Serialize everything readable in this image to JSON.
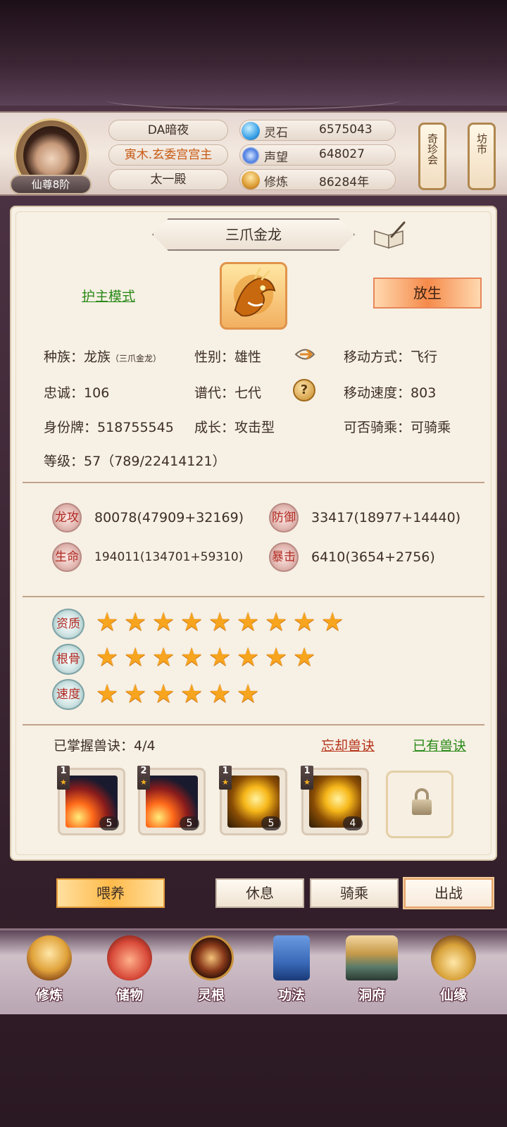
{
  "header": {
    "player_name": "DA暗夜",
    "title": "寅木.玄委宫宫主",
    "palace": "太一殿",
    "rank": "仙尊8阶",
    "resources": [
      {
        "name": "灵石",
        "value": "6575043",
        "icon": "spirit-stone-icon",
        "color": "#3aa0e6"
      },
      {
        "name": "声望",
        "value": "648027",
        "icon": "prestige-crystal-icon",
        "color": "#4a7be0"
      },
      {
        "name": "修炼",
        "value": "86284年",
        "icon": "meditation-icon",
        "color": "#e0a23a"
      }
    ],
    "side_buttons": [
      "奇珍会",
      "坊市"
    ]
  },
  "pet": {
    "name": "三爪金龙",
    "guard_mode": "护主模式",
    "release": "放生",
    "info": {
      "race_label": "种族：",
      "race": "龙族",
      "race_sub": "（三爪金龙）",
      "gender_label": "性别：",
      "gender": "雄性",
      "move_label": "移动方式：",
      "move": "飞行",
      "loyalty_label": "忠诚：",
      "loyalty": "106",
      "gen_label": "谱代：",
      "gen": "七代",
      "speed_label": "移动速度：",
      "speed": "803",
      "id_label": "身份牌：",
      "id": "518755545",
      "growth_label": "成长：",
      "growth": "攻击型",
      "ride_label": "可否骑乘：",
      "ride": "可骑乘",
      "level_label": "等级：",
      "level": "57（789/22414121）"
    },
    "stats": [
      {
        "name": "龙攻",
        "value": "80078(47909+32169)"
      },
      {
        "name": "防御",
        "value": "33417(18977+14440)"
      },
      {
        "name": "生命",
        "value": "194011(134701+59310)"
      },
      {
        "name": "暴击",
        "value": "6410(3654+2756)"
      }
    ],
    "aptitudes": [
      {
        "name": "资质",
        "stars": 9
      },
      {
        "name": "根骨",
        "stars": 8
      },
      {
        "name": "速度",
        "stars": 6
      }
    ],
    "skills": {
      "mastered_label": "已掌握兽诀：4/4",
      "forget": "忘却兽诀",
      "owned": "已有兽诀",
      "items": [
        {
          "level": "1",
          "count": "5",
          "art": "fire"
        },
        {
          "level": "2",
          "count": "5",
          "art": "fire"
        },
        {
          "level": "1",
          "count": "5",
          "art": "gold"
        },
        {
          "level": "1",
          "count": "4",
          "art": "gold"
        }
      ]
    },
    "actions": {
      "feed": "喂养",
      "rest": "休息",
      "ride": "骑乘",
      "battle": "出战"
    }
  },
  "nav": [
    {
      "label": "修炼",
      "icon": "cultivate-icon",
      "color": "#e0a23a"
    },
    {
      "label": "储物",
      "icon": "storage-bag-icon",
      "color": "#d84a3a"
    },
    {
      "label": "灵根",
      "icon": "spirit-root-icon",
      "color": "#8a3a1a"
    },
    {
      "label": "功法",
      "icon": "technique-book-icon",
      "color": "#3a6ab8"
    },
    {
      "label": "洞府",
      "icon": "cave-dwelling-icon",
      "color": "#c79a4a"
    },
    {
      "label": "仙缘",
      "icon": "fortune-gourd-icon",
      "color": "#d8a23a"
    }
  ]
}
